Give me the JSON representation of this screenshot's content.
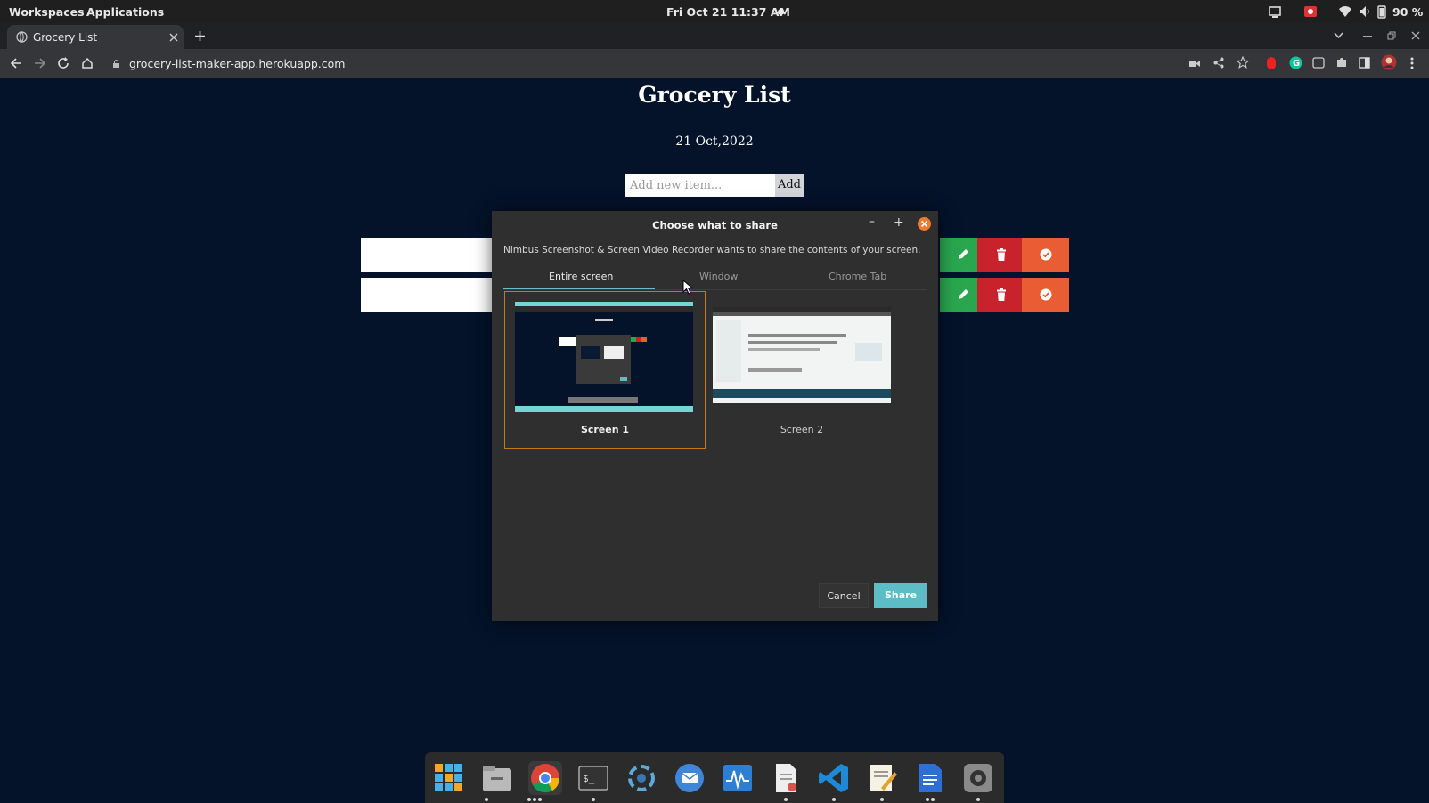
{
  "topbar": {
    "workspaces": "Workspaces",
    "applications": "Applications",
    "clock": "Fri Oct 21  11:37 AM",
    "battery": "90 %"
  },
  "browser": {
    "tab_title": "Grocery List",
    "url": "grocery-list-maker-app.herokuapp.com"
  },
  "page": {
    "title": "Grocery List",
    "date": "21 Oct,2022",
    "new_item_placeholder": "Add new item...",
    "add_label": "Add"
  },
  "dialog": {
    "title": "Choose what to share",
    "message": "Nimbus Screenshot & Screen Video Recorder wants to share the contents of your screen.",
    "tabs": [
      "Entire screen",
      "Window",
      "Chrome Tab"
    ],
    "active_tab": "Entire screen",
    "screens": [
      "Screen 1",
      "Screen 2"
    ],
    "cancel_label": "Cancel",
    "share_label": "Share"
  },
  "colors": {
    "page_bg": "#04122a",
    "edit": "#2aa64f",
    "delete": "#c8232c",
    "done": "#e85d33",
    "accent": "#5cbdc6",
    "selection_border": "#c9761c"
  },
  "dock": {
    "apps": [
      "app-grid",
      "files",
      "chrome",
      "terminal",
      "krita",
      "mail",
      "system-monitor",
      "document-viewer",
      "vscode",
      "text-editor",
      "writer",
      "settings"
    ]
  }
}
